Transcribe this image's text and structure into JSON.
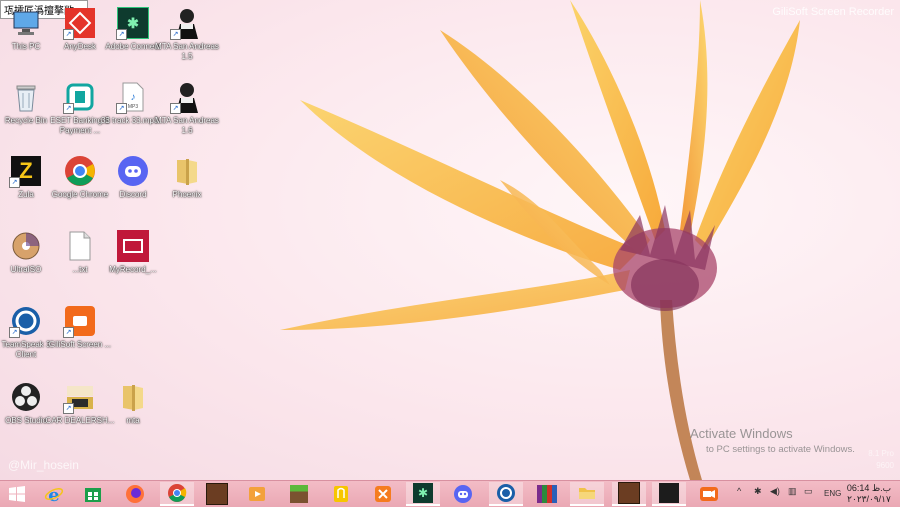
{
  "overlay_title": "瓨攉匠潙擅摮敞…",
  "watermarks": {
    "recorder": "GiliSoft Screen Recorder",
    "user": "@Mir_hosein"
  },
  "activate_windows": {
    "heading": "Activate Windows",
    "subtext": "to PC settings to activate Windows."
  },
  "side_info": [
    "8.1 Pro",
    "9600"
  ],
  "desktop_icons": [
    {
      "label": "This PC",
      "icon": "this-pc-icon"
    },
    {
      "label": "AnyDesk",
      "icon": "anydesk-icon"
    },
    {
      "label": "Adobe Connect",
      "icon": "adobe-connect-icon"
    },
    {
      "label": "MTA San Andreas 1.5",
      "icon": "mta-icon"
    },
    {
      "label": "Recycle Bin",
      "icon": "recycle-bin-icon"
    },
    {
      "label": "ESET Banking & Payment ...",
      "icon": "eset-icon"
    },
    {
      "label": "33 track 33.mp3...",
      "icon": "mp3-file-icon"
    },
    {
      "label": "MTA San Andreas 1.6",
      "icon": "mta-icon"
    },
    {
      "label": "Zula",
      "icon": "zula-icon"
    },
    {
      "label": "Google Chrome",
      "icon": "chrome-icon"
    },
    {
      "label": "Discord",
      "icon": "discord-icon"
    },
    {
      "label": "Phoenix",
      "icon": "folder-icon"
    },
    {
      "label": "UltraISO",
      "icon": "ultraiso-icon"
    },
    {
      "label": "...txt",
      "icon": "text-file-icon"
    },
    {
      "label": "MyRecord_...",
      "icon": "myrecord-icon"
    },
    {
      "label": "TeamSpeak 3 Client",
      "icon": "teamspeak-icon"
    },
    {
      "label": "GiliSoft Screen ...",
      "icon": "gilisoft-icon"
    },
    {
      "label": "OBS Studio",
      "icon": "obs-icon"
    },
    {
      "label": "CAR DEALERSH...",
      "icon": "car-dealership-icon"
    },
    {
      "label": "mta",
      "icon": "folder-icon"
    }
  ],
  "taskbar": {
    "apps": [
      {
        "name": "start-button",
        "icon": "windows-logo-icon"
      },
      {
        "name": "internet-explorer",
        "icon": "ie-icon"
      },
      {
        "name": "store",
        "icon": "store-icon"
      },
      {
        "name": "firefox",
        "icon": "firefox-icon"
      },
      {
        "name": "chrome",
        "icon": "chrome-icon"
      },
      {
        "name": "game-1",
        "icon": "gta-icon"
      },
      {
        "name": "media-player",
        "icon": "media-player-icon"
      },
      {
        "name": "minecraft",
        "icon": "minecraft-icon"
      },
      {
        "name": "notes",
        "icon": "notes-icon"
      },
      {
        "name": "xampp",
        "icon": "xampp-icon"
      },
      {
        "name": "adobe-connect",
        "icon": "adobe-connect-icon"
      },
      {
        "name": "discord",
        "icon": "discord-icon"
      },
      {
        "name": "teamspeak",
        "icon": "teamspeak-icon"
      },
      {
        "name": "winrar",
        "icon": "winrar-icon"
      },
      {
        "name": "file-explorer",
        "icon": "file-explorer-icon"
      },
      {
        "name": "game-2",
        "icon": "gta-icon"
      },
      {
        "name": "mta",
        "icon": "mta-icon"
      },
      {
        "name": "recorder",
        "icon": "camera-icon"
      }
    ],
    "tray": {
      "chevron": "^",
      "language": "ENG",
      "clock_time": "06:14 ب.ظ",
      "clock_date": "۲۰۲۳/۰۹/۱۷"
    }
  }
}
